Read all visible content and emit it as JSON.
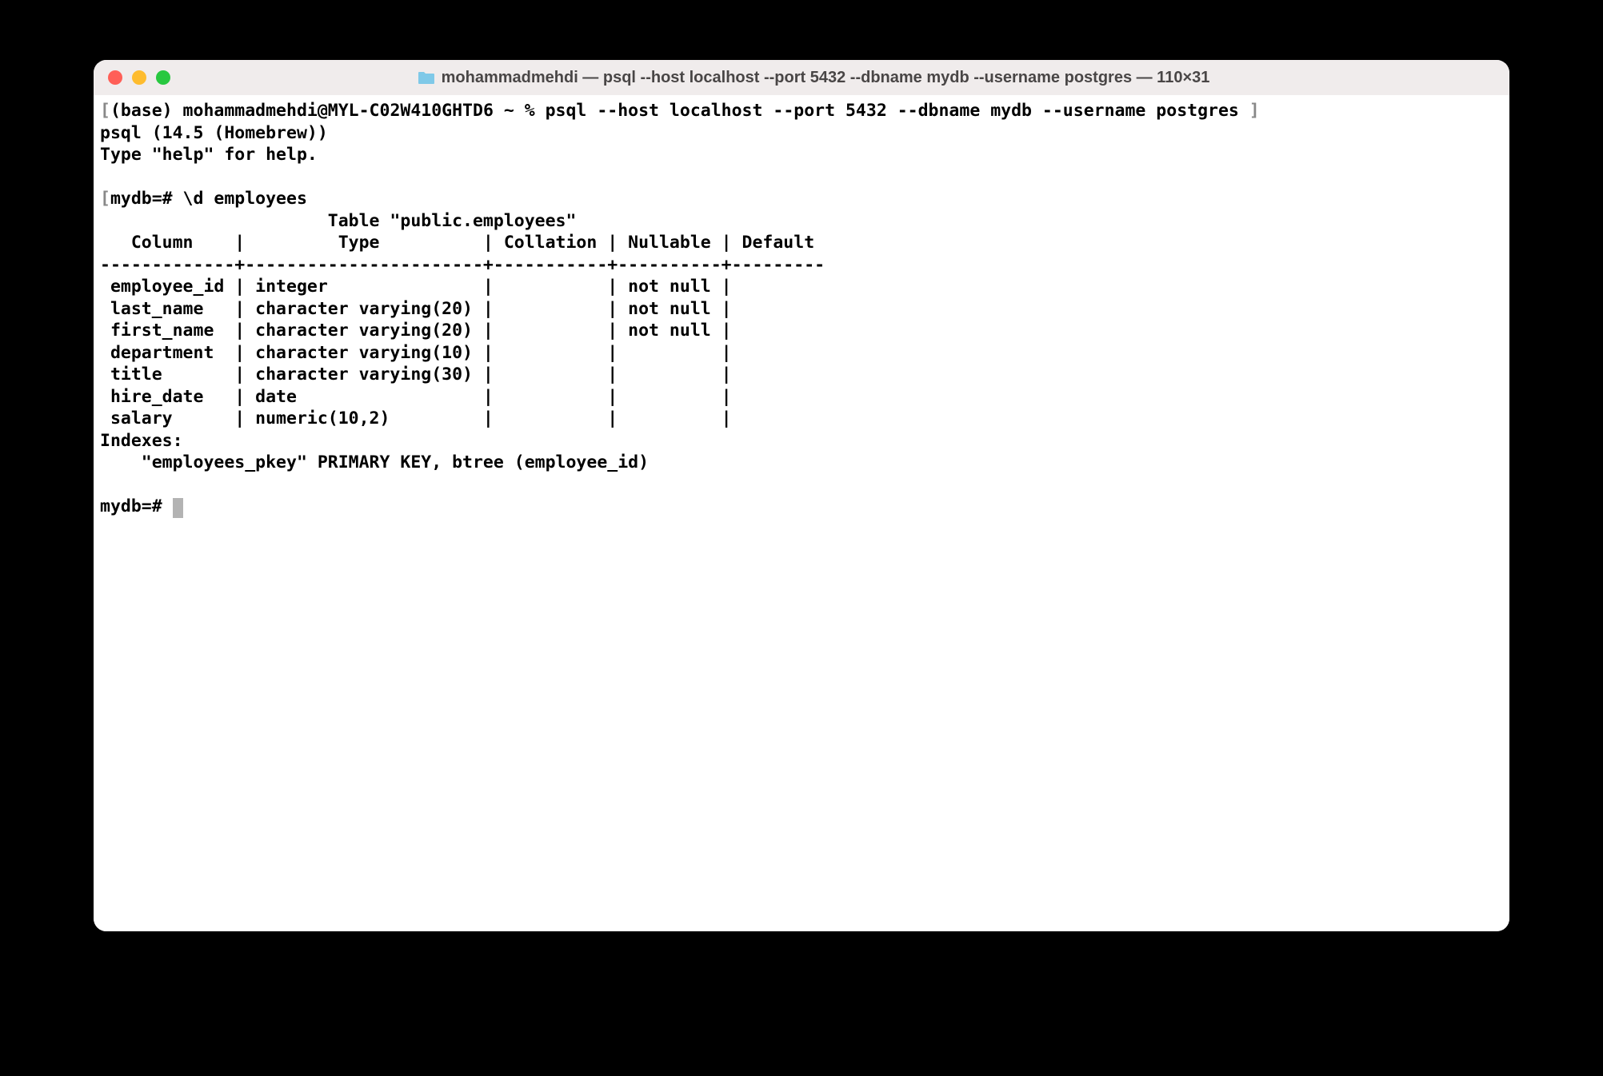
{
  "window": {
    "title": "mohammadmehdi — psql --host localhost --port 5432 --dbname mydb --username postgres — 110×31"
  },
  "terminal": {
    "line1_left": "[",
    "line1": "(base) mohammadmehdi@MYL-C02W410GHTD6 ~ % psql --host localhost --port 5432 --dbname mydb --username postgres",
    "line1_right": " ]",
    "line2": "psql (14.5 (Homebrew))",
    "line3": "Type \"help\" for help.",
    "blank1": "",
    "line4_left": "[",
    "line4": "mydb=# \\d employees",
    "line4_right": "]",
    "line5": "                      Table \"public.employees\"",
    "line6": "   Column    |         Type          | Collation | Nullable | Default ",
    "line7": "-------------+-----------------------+-----------+----------+---------",
    "row1": " employee_id | integer               |           | not null | ",
    "row2": " last_name   | character varying(20) |           | not null | ",
    "row3": " first_name  | character varying(20) |           | not null | ",
    "row4": " department  | character varying(10) |           |          | ",
    "row5": " title       | character varying(30) |           |          | ",
    "row6": " hire_date   | date                  |           |          | ",
    "row7": " salary      | numeric(10,2)         |           |          | ",
    "idx1": "Indexes:",
    "idx2": "    \"employees_pkey\" PRIMARY KEY, btree (employee_id)",
    "blank2": "",
    "prompt": "mydb=# "
  }
}
